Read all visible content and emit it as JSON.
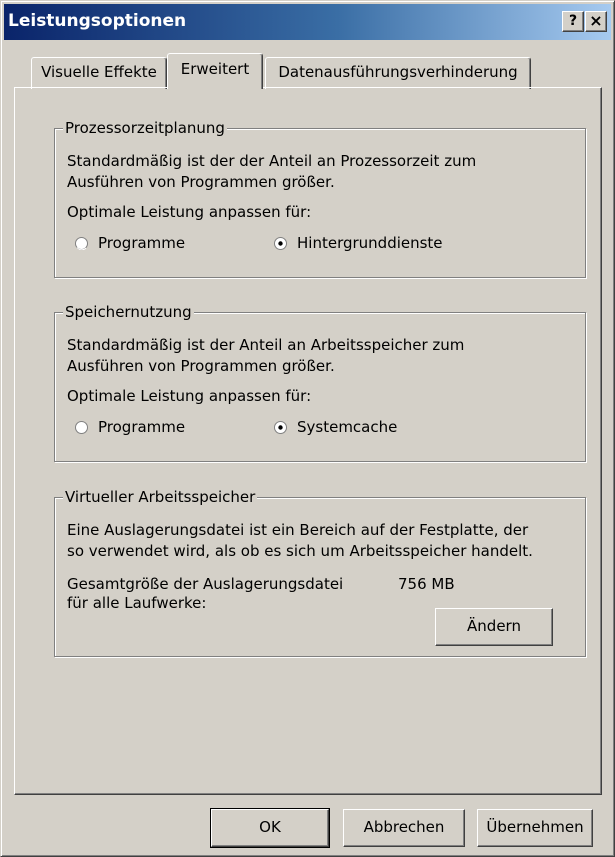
{
  "window": {
    "title": "Leistungsoptionen",
    "help_glyph": "?",
    "close_glyph": "×"
  },
  "tabs": [
    {
      "label": "Visuelle Effekte",
      "active": false
    },
    {
      "label": "Erweitert",
      "active": true
    },
    {
      "label": "Datenausführungsverhinderung",
      "active": false
    }
  ],
  "processor": {
    "title": "Prozessorzeitplanung",
    "desc_line1": "Standardmäßig ist der der Anteil an Prozessorzeit zum",
    "desc_line2": "Ausführen von Programmen größer.",
    "adjust_label": "Optimale Leistung anpassen für:",
    "options": [
      {
        "label": "Programme",
        "selected": false
      },
      {
        "label": "Hintergrunddienste",
        "selected": true
      }
    ]
  },
  "memory": {
    "title": "Speichernutzung",
    "desc_line1": "Standardmäßig ist der Anteil an Arbeitsspeicher zum",
    "desc_line2": "Ausführen von Programmen größer.",
    "adjust_label": "Optimale Leistung anpassen für:",
    "options": [
      {
        "label": "Programme",
        "selected": false
      },
      {
        "label": "Systemcache",
        "selected": true
      }
    ]
  },
  "virtual": {
    "title": "Virtueller Arbeitsspeicher",
    "desc_line1": "Eine Auslagerungsdatei ist ein Bereich auf der Festplatte, der",
    "desc_line2": "so verwendet wird, als ob es sich um Arbeitsspeicher handelt.",
    "size_label_line1": "Gesamtgröße der Auslagerungsdatei",
    "size_label_line2": "für alle Laufwerke:",
    "size_value": "756 MB",
    "change_button": "Ändern"
  },
  "buttons": {
    "ok": "OK",
    "cancel": "Abbrechen",
    "apply": "Übernehmen"
  }
}
